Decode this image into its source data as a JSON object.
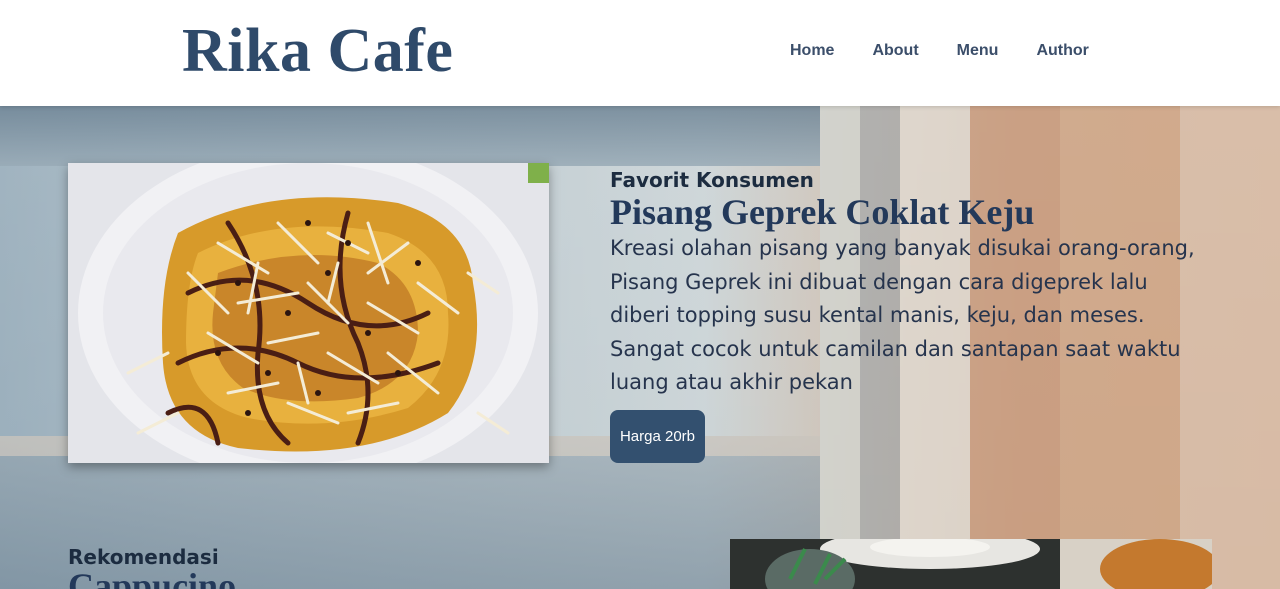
{
  "header": {
    "logo": "Rika Cafe",
    "nav": [
      {
        "label": "Home"
      },
      {
        "label": "About"
      },
      {
        "label": "Menu"
      },
      {
        "label": "Author"
      }
    ]
  },
  "featured": {
    "subtitle": "Favorit Konsumen",
    "title": "Pisang Geprek Coklat Keju",
    "description": "Kreasi olahan pisang yang banyak disukai orang-orang, Pisang Geprek ini dibuat dengan cara digeprek lalu diberi topping susu kental manis, keju, dan meses. Sangat cocok untuk camilan dan santapan saat waktu luang atau akhir pekan",
    "price_label": "Harga 20rb"
  },
  "recommendation": {
    "subtitle": "Rekomendasi",
    "title": "Cappucino"
  },
  "colors": {
    "brand": "#2f4a6a",
    "button": "#33506f",
    "text_dark": "#23395a"
  }
}
